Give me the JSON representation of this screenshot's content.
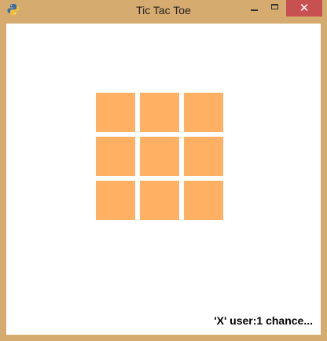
{
  "window": {
    "title": "Tic Tac Toe",
    "close_glyph": "✕",
    "app_icon": "python-icon"
  },
  "colors": {
    "frame": "#d6ab70",
    "cell": "#ffb062",
    "close_button": "#c75050",
    "background": "#ffffff"
  },
  "board": {
    "cells": [
      "",
      "",
      "",
      "",
      "",
      "",
      "",
      "",
      ""
    ]
  },
  "status": {
    "text": "'X' user:1 chance..."
  }
}
